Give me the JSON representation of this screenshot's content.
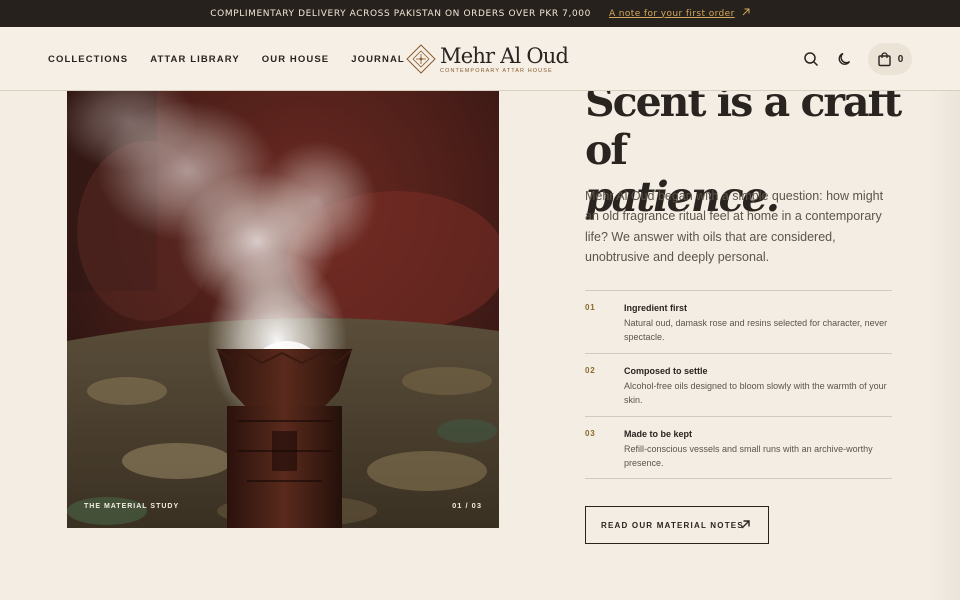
{
  "announcement": {
    "message": "COMPLIMENTARY DELIVERY ACROSS PAKISTAN ON ORDERS OVER PKR 7,000",
    "note_link": "A note for your first order",
    "note_icon": "arrow-up-right-icon"
  },
  "header": {
    "nav": [
      {
        "label": "COLLECTIONS"
      },
      {
        "label": "ATTAR LIBRARY"
      },
      {
        "label": "OUR HOUSE"
      },
      {
        "label": "JOURNAL"
      }
    ],
    "logo": {
      "name": "Mehr Al Oud",
      "tagline": "CONTEMPORARY ATTAR HOUSE"
    },
    "actions": {
      "search_icon": "search-icon",
      "theme_icon": "moon-icon",
      "cart_icon": "shopping-bag-icon",
      "cart_count": "0"
    }
  },
  "hero_image": {
    "caption": "THE MATERIAL STUDY",
    "counter": "01 / 03"
  },
  "content": {
    "headline_line1": "Scent is a craft of",
    "headline_line2": "patience.",
    "intro": "Mehr Al Oud began with a simple question: how might an old fragrance ritual feel at home in a contemporary life? We answer with oils that are considered, unobtrusive and deeply personal.",
    "features": [
      {
        "number": "01",
        "title": "Ingredient first",
        "description": "Natural oud, damask rose and resins selected for character, never spectacle."
      },
      {
        "number": "02",
        "title": "Composed to settle",
        "description": "Alcohol-free oils designed to bloom slowly with the warmth of your skin."
      },
      {
        "number": "03",
        "title": "Made to be kept",
        "description": "Refill-conscious vessels and small runs with an archive-worthy presence."
      }
    ],
    "cta_label": "READ OUR MATERIAL NOTES",
    "cta_icon": "arrow-up-right-icon"
  },
  "colors": {
    "background": "#f3ede3",
    "announcement_bg": "#27211d",
    "accent_gold": "#d3a85c",
    "text_dark": "#2a2420"
  }
}
